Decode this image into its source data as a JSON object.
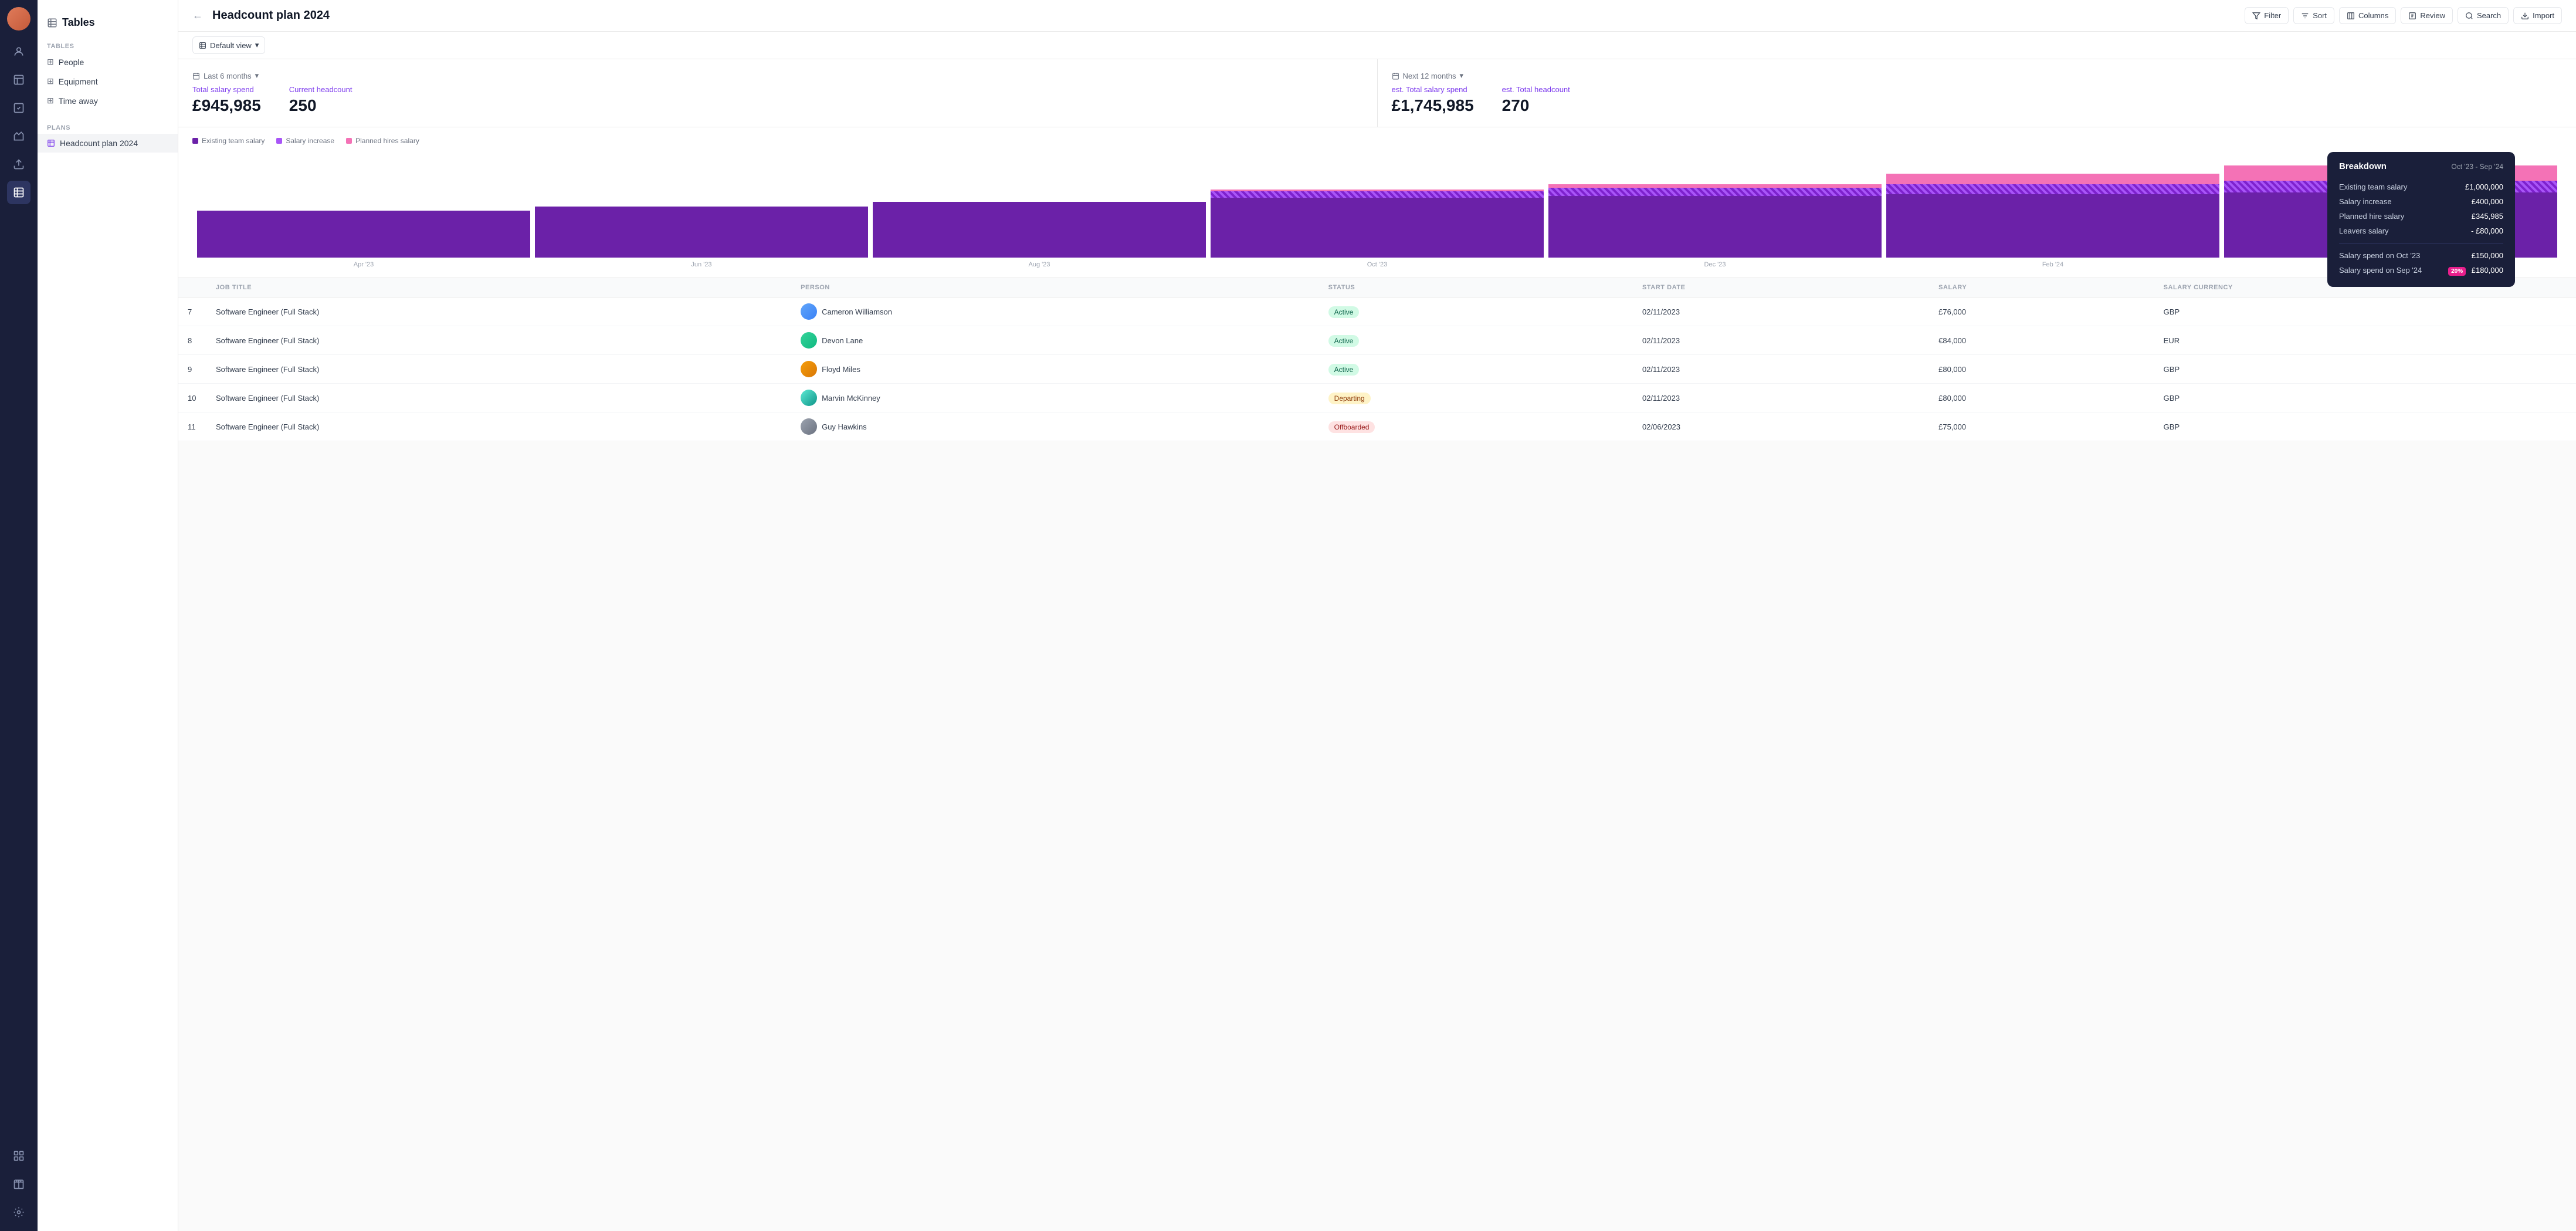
{
  "app": {
    "title": "Tables"
  },
  "sidebar": {
    "tables_section": "Tables",
    "plans_section": "Plans",
    "tables": [
      {
        "id": "people",
        "label": "People"
      },
      {
        "id": "equipment",
        "label": "Equipment"
      },
      {
        "id": "time-away",
        "label": "Time away"
      }
    ],
    "plans": [
      {
        "id": "headcount-2024",
        "label": "Headcount plan 2024",
        "active": true
      }
    ]
  },
  "topbar": {
    "title": "Headcount plan 2024",
    "actions": {
      "filter": "Filter",
      "sort": "Sort",
      "columns": "Columns",
      "review": "Review",
      "search": "Search",
      "import": "Import"
    }
  },
  "viewbar": {
    "view_label": "Default view",
    "chevron": "▾"
  },
  "stats": {
    "left": {
      "period": "Last 6 months",
      "metrics": [
        {
          "label": "Total salary spend",
          "value": "£945,985"
        },
        {
          "label": "Current headcount",
          "value": "250"
        }
      ]
    },
    "right": {
      "period": "Next 12 months",
      "metrics": [
        {
          "label": "est. Total salary spend",
          "value": "£1,745,985"
        },
        {
          "label": "est. Total headcount",
          "value": "270"
        }
      ]
    }
  },
  "chart": {
    "legend": [
      {
        "label": "Existing team salary",
        "color": "#6b21a8"
      },
      {
        "label": "Salary increase",
        "color": "#a855f7"
      },
      {
        "label": "Planned hires salary",
        "color": "#f472b6"
      }
    ],
    "bars": [
      {
        "month": "Apr '23",
        "existing": 55,
        "increase": 0,
        "planned": 0
      },
      {
        "month": "Jun '23",
        "existing": 60,
        "increase": 0,
        "planned": 0
      },
      {
        "month": "Aug '23",
        "existing": 65,
        "increase": 0,
        "planned": 0
      },
      {
        "month": "Oct '23",
        "existing": 70,
        "increase": 8,
        "planned": 2
      },
      {
        "month": "Dec '23",
        "existing": 72,
        "increase": 10,
        "planned": 4
      },
      {
        "month": "Feb '24",
        "existing": 74,
        "increase": 12,
        "planned": 12
      },
      {
        "month": "—",
        "existing": 76,
        "increase": 14,
        "planned": 18
      }
    ]
  },
  "tooltip": {
    "title": "Breakdown",
    "period": "Oct '23 - Sep '24",
    "rows": [
      {
        "label": "Existing team salary",
        "value": "£1,000,000",
        "badge": null
      },
      {
        "label": "Salary increase",
        "value": "£400,000",
        "badge": null
      },
      {
        "label": "Planned hire salary",
        "value": "£345,985",
        "badge": null
      },
      {
        "label": "Leavers salary",
        "value": "- £80,000",
        "badge": null
      }
    ],
    "divider": true,
    "extra_rows": [
      {
        "label": "Salary spend on Oct '23",
        "value": "£150,000",
        "badge": null
      },
      {
        "label": "Salary spend on Sep '24",
        "value": "£180,000",
        "badge": "20%"
      }
    ]
  },
  "table": {
    "columns": [
      "",
      "JOB TITLE",
      "PERSON",
      "STATUS",
      "START DATE",
      "SALARY",
      "SALARY CURRENCY"
    ],
    "rows": [
      {
        "num": "7",
        "job_title": "Software Engineer (Full Stack)",
        "person_name": "Cameron Williamson",
        "avatar_class": "av-blue",
        "status": "Active",
        "status_class": "status-active",
        "start_date": "02/11/2023",
        "salary": "£76,000",
        "currency": "GBP"
      },
      {
        "num": "8",
        "job_title": "Software Engineer (Full Stack)",
        "person_name": "Devon Lane",
        "avatar_class": "av-green",
        "status": "Active",
        "status_class": "status-active",
        "start_date": "02/11/2023",
        "salary": "€84,000",
        "currency": "EUR"
      },
      {
        "num": "9",
        "job_title": "Software Engineer (Full Stack)",
        "person_name": "Floyd Miles",
        "avatar_class": "av-orange",
        "status": "Active",
        "status_class": "status-active",
        "start_date": "02/11/2023",
        "salary": "£80,000",
        "currency": "GBP"
      },
      {
        "num": "10",
        "job_title": "Software Engineer (Full Stack)",
        "person_name": "Marvin McKinney",
        "avatar_class": "av-teal",
        "status": "Departing",
        "status_class": "status-departing",
        "start_date": "02/11/2023",
        "salary": "£80,000",
        "currency": "GBP"
      },
      {
        "num": "11",
        "job_title": "Software Engineer (Full Stack)",
        "person_name": "Guy Hawkins",
        "avatar_class": "av-gray",
        "status": "Offboarded",
        "status_class": "status-offboarded",
        "start_date": "02/06/2023",
        "salary": "£75,000",
        "currency": "GBP"
      }
    ]
  }
}
